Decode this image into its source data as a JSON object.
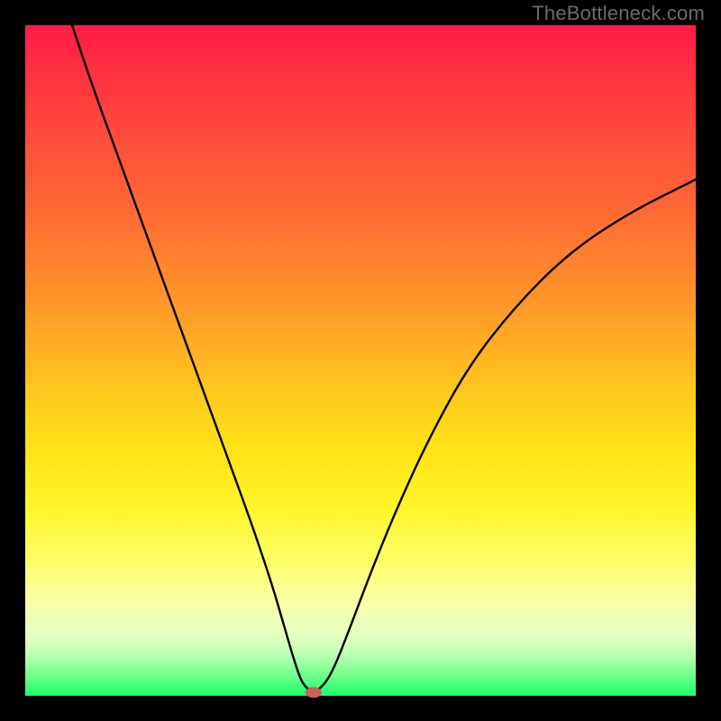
{
  "watermark": "TheBottleneck.com",
  "colors": {
    "page_bg": "#000000",
    "curve_stroke": "#000000",
    "marker_fill": "#cf5d5d",
    "gradient_stops": [
      "#ff1b47",
      "#ff3a3f",
      "#ff6a34",
      "#ff9928",
      "#ffc91e",
      "#ffe516",
      "#fff52a",
      "#feff68",
      "#f7ffa6",
      "#e6ffc3",
      "#b9ffb3",
      "#6fff8a",
      "#1cff6e"
    ]
  },
  "chart_data": {
    "type": "line",
    "title": "",
    "xlabel": "",
    "ylabel": "",
    "xlim": [
      0,
      100
    ],
    "ylim": [
      0,
      100
    ],
    "legend": false,
    "grid": false,
    "marker": {
      "x": 43,
      "y": 0.5,
      "shape": "oval",
      "color": "#cf5d5d"
    },
    "series": [
      {
        "name": "bottleneck-curve",
        "x": [
          7,
          10,
          14,
          18,
          22,
          26,
          30,
          34,
          37,
          39,
          40.5,
          41.5,
          43,
          44.5,
          46,
          48,
          51,
          55,
          60,
          66,
          73,
          81,
          90,
          100
        ],
        "y": [
          100,
          91,
          80,
          69,
          58,
          47,
          36,
          25,
          16,
          9,
          4,
          1.5,
          0.5,
          1.5,
          4,
          9,
          17,
          27,
          38,
          49,
          58,
          66,
          72,
          77
        ]
      }
    ]
  }
}
